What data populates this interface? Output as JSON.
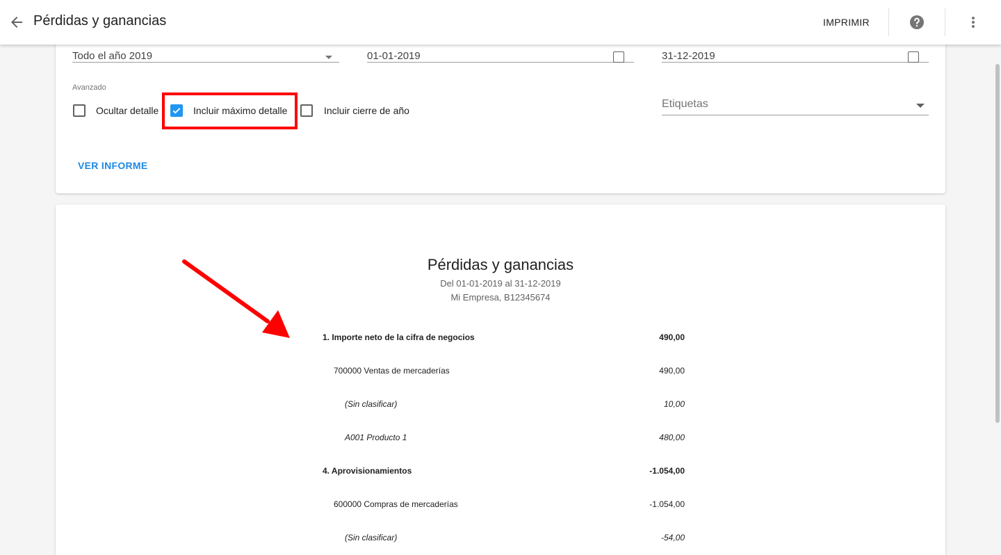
{
  "header": {
    "title": "Pérdidas y ganancias",
    "print_label": "IMPRIMIR"
  },
  "filters": {
    "period_value": "Todo el año 2019",
    "from_value": "01-01-2019",
    "to_value": "31-12-2019",
    "advanced_label": "Avanzado",
    "checkboxes": [
      {
        "label": "Ocultar detalle",
        "checked": false
      },
      {
        "label": "Incluir máximo detalle",
        "checked": true
      },
      {
        "label": "Incluir cierre de año",
        "checked": false
      }
    ],
    "tags_placeholder": "Etiquetas",
    "view_button": "VER INFORME"
  },
  "report": {
    "title": "Pérdidas y ganancias",
    "period": "Del 01-01-2019 al 31-12-2019",
    "company": "Mi Empresa, B12345674",
    "rows": [
      {
        "label": "1. Importe neto de la cifra de negocios",
        "amount": "490,00",
        "level": 0
      },
      {
        "label": "700000 Ventas de mercaderías",
        "amount": "490,00",
        "level": 1
      },
      {
        "label": "(Sin clasificar)",
        "amount": "10,00",
        "level": 2
      },
      {
        "label": "A001 Producto 1",
        "amount": "480,00",
        "level": 2
      },
      {
        "label": "4. Aprovisionamientos",
        "amount": "-1.054,00",
        "level": 0
      },
      {
        "label": "600000 Compras de mercaderías",
        "amount": "-1.054,00",
        "level": 1
      },
      {
        "label": "(Sin clasificar)",
        "amount": "-54,00",
        "level": 2
      }
    ]
  },
  "colors": {
    "accent": "#2196f3",
    "link": "#1e88e5",
    "annotation": "#ff0000"
  }
}
